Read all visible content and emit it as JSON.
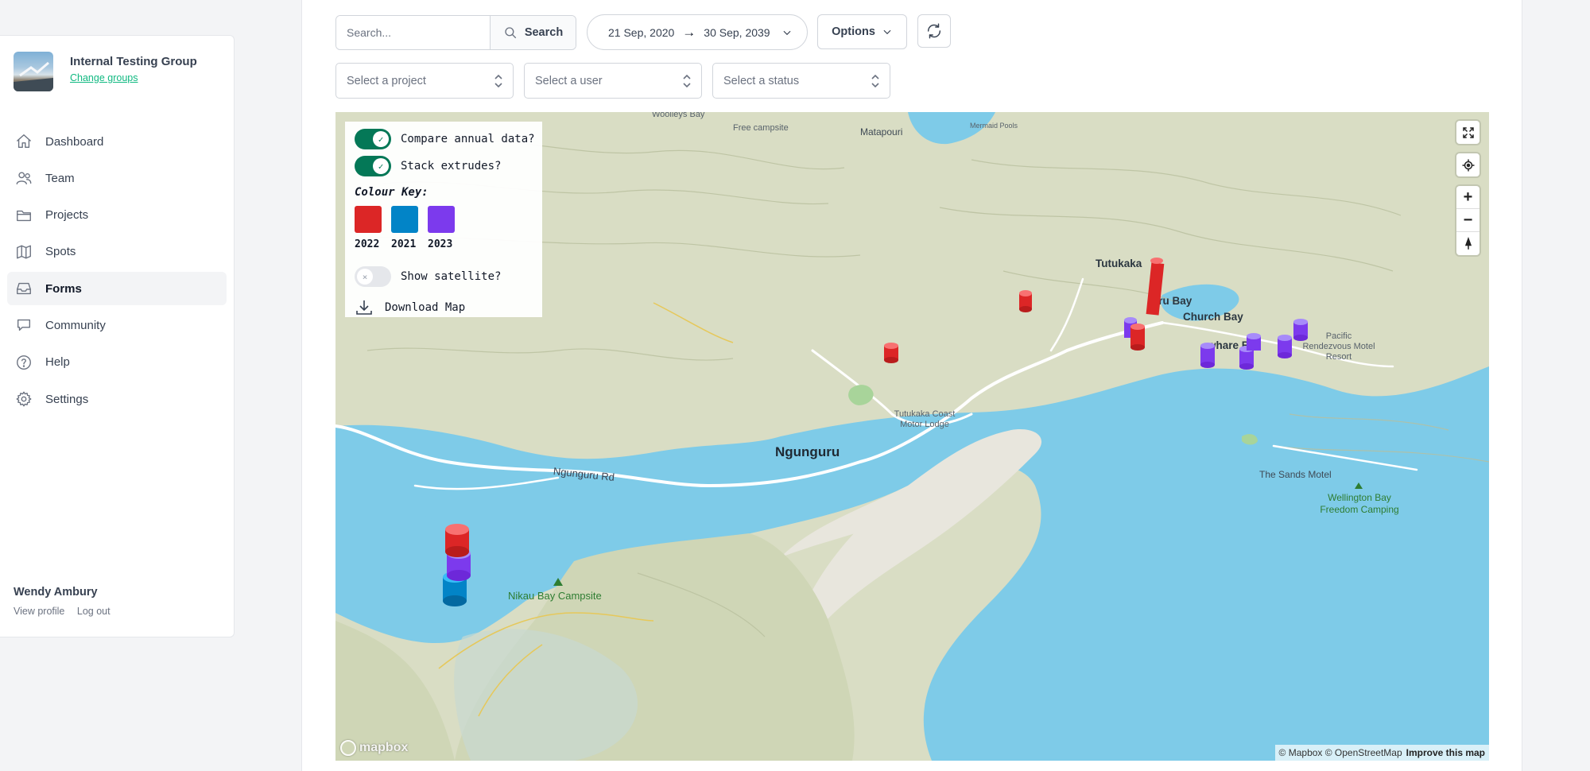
{
  "group": {
    "name": "Internal Testing Group",
    "change_label": "Change groups"
  },
  "nav": [
    {
      "label": "Dashboard",
      "icon": "home-icon"
    },
    {
      "label": "Team",
      "icon": "users-icon"
    },
    {
      "label": "Projects",
      "icon": "folder-icon"
    },
    {
      "label": "Spots",
      "icon": "map-icon"
    },
    {
      "label": "Forms",
      "icon": "inbox-icon",
      "active": true
    },
    {
      "label": "Community",
      "icon": "chat-icon"
    },
    {
      "label": "Help",
      "icon": "help-icon"
    },
    {
      "label": "Settings",
      "icon": "gear-icon"
    }
  ],
  "user": {
    "name": "Wendy Ambury",
    "view_profile": "View profile",
    "logout": "Log out"
  },
  "toolbar": {
    "search_placeholder": "Search...",
    "search_label": "Search",
    "date_from": "21 Sep, 2020",
    "date_arrow": "→",
    "date_to": "30 Sep, 2039",
    "options_label": "Options"
  },
  "filters": {
    "project_placeholder": "Select a project",
    "user_placeholder": "Select a user",
    "status_placeholder": "Select a status"
  },
  "map_panel": {
    "compare_label": "Compare annual data?",
    "compare_on": true,
    "stack_label": "Stack extrudes?",
    "stack_on": true,
    "colour_key_title": "Colour Key:",
    "colour_key": [
      {
        "year": "2022",
        "color": "#dc2626"
      },
      {
        "year": "2021",
        "color": "#0284c7"
      },
      {
        "year": "2023",
        "color": "#7c3aed"
      }
    ],
    "satellite_label": "Show satellite?",
    "satellite_on": false,
    "download_label": "Download Map"
  },
  "map": {
    "labels": {
      "ngunguru": "Ngunguru",
      "tutukaka": "Tutukaka",
      "matapouri": "Matapouri",
      "church_bay": "Church Bay",
      "uru_bay": "uru Bay",
      "whare_bay": "whare  Ba",
      "ngunguru_rd": "Ngunguru Rd",
      "nikau": "Nikau Bay Campsite",
      "coast_lodge": "Tutukaka Coast Motor Lodge",
      "sands_motel": "The Sands Motel",
      "wellington_bay": "Wellington Bay Freedom Camping",
      "pacific": "Pacific Rendezvous Motel Resort",
      "free_campsite": "Free campsite",
      "woolleys": "Woolleys Bay",
      "mermaid": "Mermaid Pools"
    },
    "logo": "mapbox",
    "attribution": "© Mapbox © OpenStreetMap",
    "improve": "Improve this map"
  }
}
